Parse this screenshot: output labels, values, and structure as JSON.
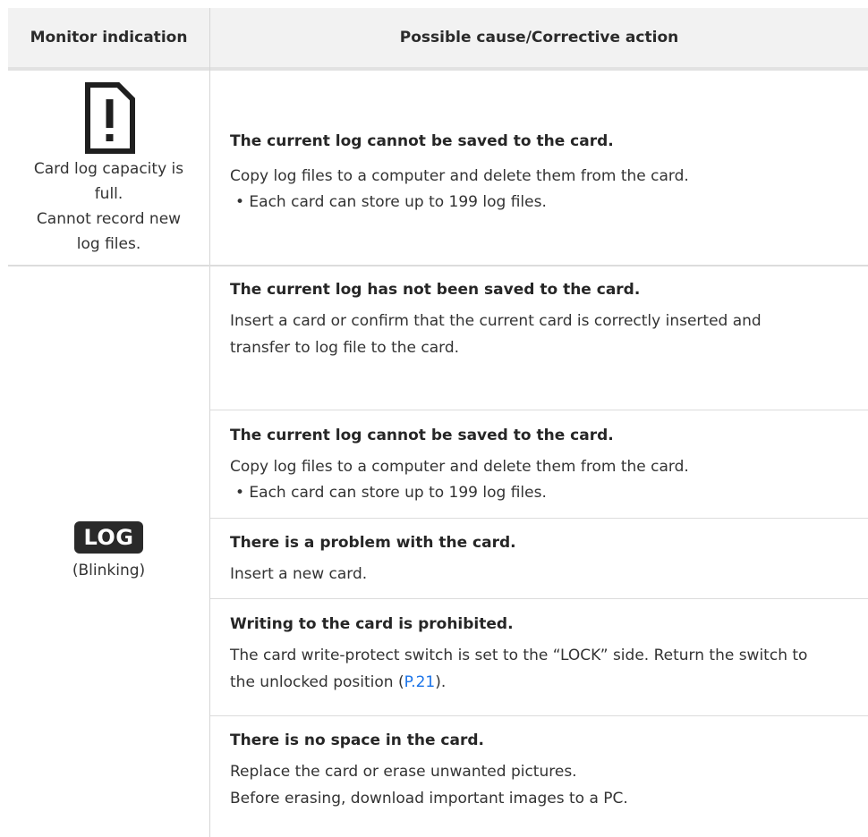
{
  "header": {
    "col1": "Monitor indication",
    "col2": "Possible cause/Corrective action"
  },
  "row1": {
    "icon": "card-warning-icon",
    "indication": [
      "Card log capacity is",
      "full.",
      "Cannot record new",
      "log files."
    ],
    "title": "The current log cannot be saved to the card.",
    "body": "Copy log files to a computer and delete them from the card.",
    "bullet": "• Each card can store up to 199 log files."
  },
  "row2": {
    "badge": "LOG",
    "status": "(Blinking)",
    "causes": [
      {
        "title": "The current log has not been saved to the card.",
        "line1": "Insert a card or confirm that the current card is correctly inserted and",
        "line2": "transfer to log file to the card."
      },
      {
        "title": "The current log cannot be saved to the card.",
        "line1": "Copy log files to a computer and delete them from the card.",
        "bullet": "• Each card can store up to 199 log files."
      },
      {
        "title": "There is a problem with the card.",
        "line1": "Insert a new card."
      },
      {
        "title": "Writing to the card is prohibited.",
        "line1": "The card write-protect switch is set to the “LOCK” side. Return the switch to",
        "line2_pre": "the unlocked position (",
        "link": "P.21",
        "line2_post": ")."
      },
      {
        "title": "There is no space in the card.",
        "line1": "Replace the card or erase unwanted pictures.",
        "line2": "Before erasing, download important images to a PC."
      }
    ]
  }
}
